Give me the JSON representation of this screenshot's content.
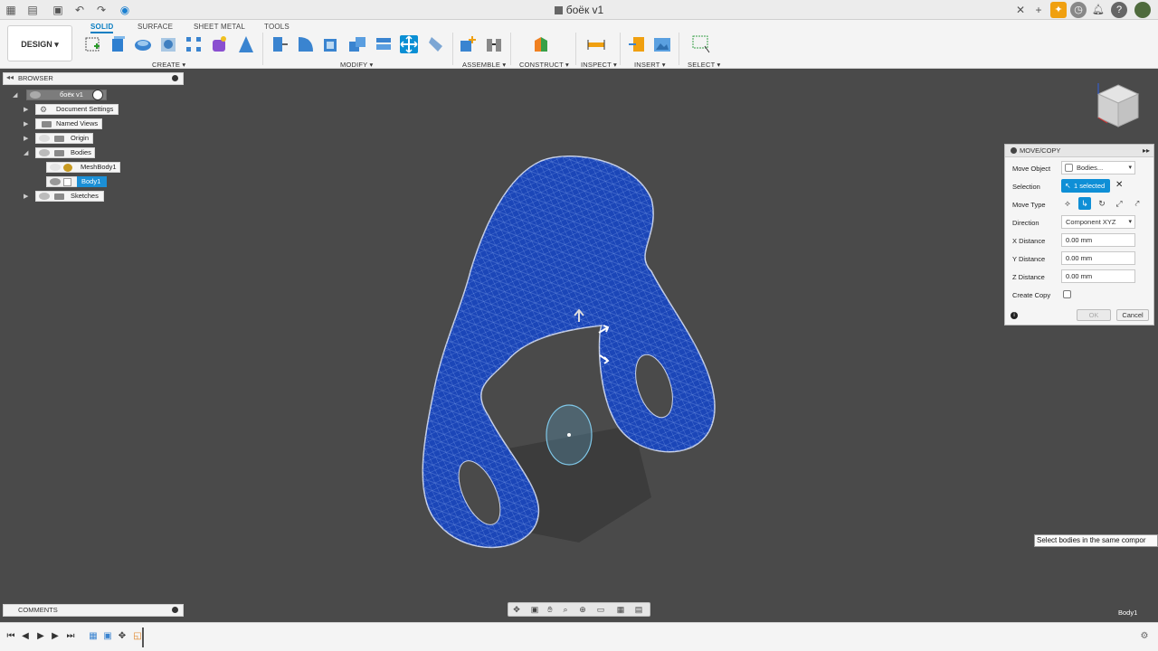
{
  "titlebar": {
    "doc_title": "боёк v1"
  },
  "toolbar": {
    "design_label": "DESIGN ▾",
    "tabs": [
      "SOLID",
      "SURFACE",
      "SHEET METAL",
      "TOOLS"
    ],
    "groups": [
      "CREATE ▾",
      "MODIFY ▾",
      "ASSEMBLE ▾",
      "CONSTRUCT ▾",
      "INSPECT ▾",
      "INSERT ▾",
      "SELECT ▾"
    ]
  },
  "browser": {
    "label": "BROWSER",
    "root": "боёк v1",
    "items": [
      "Document Settings",
      "Named Views",
      "Origin",
      "Bodies",
      "MeshBody1",
      "Body1",
      "Sketches"
    ]
  },
  "comments": {
    "label": "COMMENTS"
  },
  "movecopy": {
    "title": "MOVE/COPY",
    "move_object_label": "Move Object",
    "move_object_value": "Bodies...",
    "selection_label": "Selection",
    "selection_value": "1 selected",
    "move_type_label": "Move Type",
    "direction_label": "Direction",
    "direction_value": "Component XYZ",
    "x_label": "X Distance",
    "x_value": "0.00 mm",
    "y_label": "Y Distance",
    "y_value": "0.00 mm",
    "z_label": "Z Distance",
    "z_value": "0.00 mm",
    "create_copy_label": "Create Copy",
    "ok_label": "OK",
    "cancel_label": "Cancel"
  },
  "tooltip": {
    "text": "Select bodies in the same compor"
  },
  "viewport": {
    "body_label": "Body1",
    "mesh_color": "#1b46b8"
  },
  "colors": {
    "accent": "#0a8fd4",
    "viewport_bg": "#4a4a4a"
  }
}
